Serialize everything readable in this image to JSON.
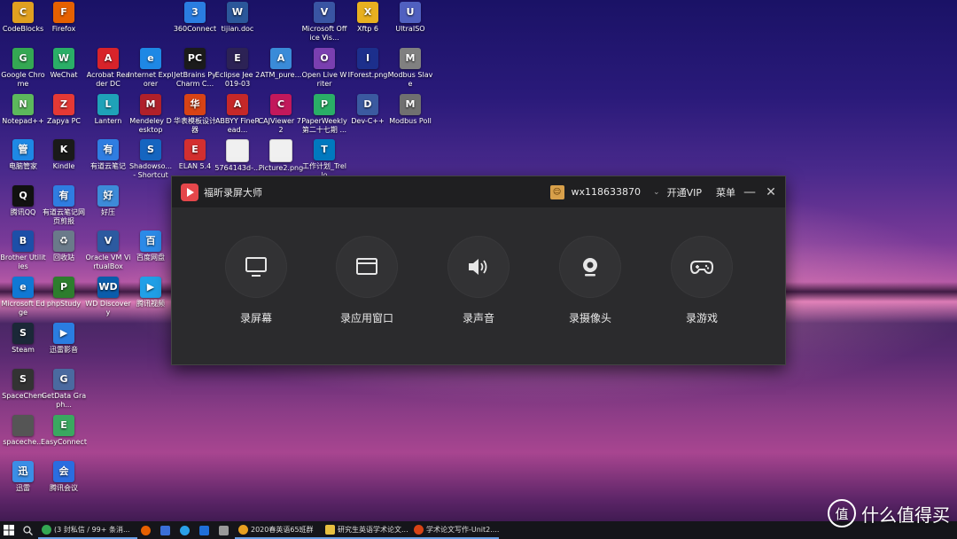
{
  "desktop": {
    "icons": [
      {
        "label": "CodeBlocks",
        "glyph": "C",
        "color": "#e0a020",
        "col": 0,
        "row": 0
      },
      {
        "label": "Firefox",
        "glyph": "F",
        "color": "#e66000",
        "col": 1,
        "row": 0
      },
      {
        "label": "360Connect",
        "glyph": "3",
        "color": "#2a7de1",
        "col": 4,
        "row": 0
      },
      {
        "label": "tijian.doc",
        "glyph": "W",
        "color": "#2b579a",
        "col": 5,
        "row": 0
      },
      {
        "label": "Microsoft Office Vis...",
        "glyph": "V",
        "color": "#3955a3",
        "col": 7,
        "row": 0
      },
      {
        "label": "Xftp 6",
        "glyph": "X",
        "color": "#e8b020",
        "col": 8,
        "row": 0
      },
      {
        "label": "UltraISO",
        "glyph": "U",
        "color": "#5060c0",
        "col": 9,
        "row": 0
      },
      {
        "label": "Google Chrome",
        "glyph": "G",
        "color": "#34a853",
        "col": 0,
        "row": 1
      },
      {
        "label": "WeChat",
        "glyph": "W",
        "color": "#2aae67",
        "col": 1,
        "row": 1
      },
      {
        "label": "Acrobat Reader DC",
        "glyph": "A",
        "color": "#d8232a",
        "col": 2,
        "row": 1
      },
      {
        "label": "Internet Explorer",
        "glyph": "e",
        "color": "#1e88e5",
        "col": 3,
        "row": 1
      },
      {
        "label": "JetBrains PyCharm C...",
        "glyph": "PC",
        "color": "#1b1b1b",
        "col": 4,
        "row": 1
      },
      {
        "label": "Eclipse Jee 2019-03",
        "glyph": "E",
        "color": "#2c2255",
        "col": 5,
        "row": 1
      },
      {
        "label": "ATM_pure...",
        "glyph": "A",
        "color": "#3a8bd8",
        "col": 6,
        "row": 1
      },
      {
        "label": "Open Live Writer",
        "glyph": "O",
        "color": "#7a3fb0",
        "col": 7,
        "row": 1
      },
      {
        "label": "IForest.png",
        "glyph": "I",
        "color": "#1c2f8c",
        "col": 8,
        "row": 1
      },
      {
        "label": "Modbus Slave",
        "glyph": "M",
        "color": "#808080",
        "col": 9,
        "row": 1
      },
      {
        "label": "Notepad++",
        "glyph": "N",
        "color": "#5cb85c",
        "col": 0,
        "row": 2
      },
      {
        "label": "Zapya PC",
        "glyph": "Z",
        "color": "#e53935",
        "col": 1,
        "row": 2
      },
      {
        "label": "Lantern",
        "glyph": "L",
        "color": "#1fa2b8",
        "col": 2,
        "row": 2
      },
      {
        "label": "Mendeley Desktop",
        "glyph": "M",
        "color": "#b0202a",
        "col": 3,
        "row": 2
      },
      {
        "label": "华表模板设计器",
        "glyph": "华",
        "color": "#d84315",
        "col": 4,
        "row": 2
      },
      {
        "label": "ABBYY FineRead...",
        "glyph": "A",
        "color": "#c62828",
        "col": 5,
        "row": 2
      },
      {
        "label": "CAJViewer 7.2",
        "glyph": "C",
        "color": "#c2185b",
        "col": 6,
        "row": 2
      },
      {
        "label": "PaperWeekly 第二十七期 ...",
        "glyph": "P",
        "color": "#2aae67",
        "col": 7,
        "row": 2
      },
      {
        "label": "Dev-C++",
        "glyph": "D",
        "color": "#3b5aa0",
        "col": 8,
        "row": 2
      },
      {
        "label": "Modbus Poll",
        "glyph": "M",
        "color": "#707070",
        "col": 9,
        "row": 2
      },
      {
        "label": "电脑管家",
        "glyph": "管",
        "color": "#1e88e5",
        "col": 0,
        "row": 3
      },
      {
        "label": "Kindle",
        "glyph": "K",
        "color": "#1a1a1a",
        "col": 1,
        "row": 3
      },
      {
        "label": "有道云笔记",
        "glyph": "有",
        "color": "#2f7de1",
        "col": 2,
        "row": 3
      },
      {
        "label": "Shadowso... - Shortcut",
        "glyph": "S",
        "color": "#1565c0",
        "col": 3,
        "row": 3
      },
      {
        "label": "ELAN 5.4",
        "glyph": "E",
        "color": "#d32f2f",
        "col": 4,
        "row": 3
      },
      {
        "label": "5764143d-...",
        "glyph": "",
        "color": "#f0f0f0",
        "col": 5,
        "row": 3
      },
      {
        "label": "Picture2.png",
        "glyph": "",
        "color": "#f0f0f0",
        "col": 6,
        "row": 3
      },
      {
        "label": "工作计划_Trello",
        "glyph": "T",
        "color": "#0079bf",
        "col": 7,
        "row": 3
      },
      {
        "label": "腾讯QQ",
        "glyph": "Q",
        "color": "#111111",
        "col": 0,
        "row": 4
      },
      {
        "label": "有道云笔记网页剪报",
        "glyph": "有",
        "color": "#2f7de1",
        "col": 1,
        "row": 4
      },
      {
        "label": "好压",
        "glyph": "好",
        "color": "#3d8bd8",
        "col": 2,
        "row": 4
      },
      {
        "label": "Brother Utilities",
        "glyph": "B",
        "color": "#1d4fa8",
        "col": 0,
        "row": 5
      },
      {
        "label": "回收站",
        "glyph": "♻",
        "color": "#6a7a8a",
        "col": 1,
        "row": 5
      },
      {
        "label": "Oracle VM VirtualBox",
        "glyph": "V",
        "color": "#2c5aa0",
        "col": 2,
        "row": 5
      },
      {
        "label": "百度网盘",
        "glyph": "百",
        "color": "#2b8ae8",
        "col": 3,
        "row": 5
      },
      {
        "label": "Microsoft Edge",
        "glyph": "e",
        "color": "#0f78d4",
        "col": 0,
        "row": 6
      },
      {
        "label": "phpStudy",
        "glyph": "P",
        "color": "#2d7d2d",
        "col": 1,
        "row": 6
      },
      {
        "label": "WD Discovery",
        "glyph": "WD",
        "color": "#0a5cab",
        "col": 2,
        "row": 6
      },
      {
        "label": "腾讯视频",
        "glyph": "▶",
        "color": "#20a0e8",
        "col": 3,
        "row": 6
      },
      {
        "label": "Steam",
        "glyph": "S",
        "color": "#1b2838",
        "col": 0,
        "row": 7
      },
      {
        "label": "迅雷影音",
        "glyph": "▶",
        "color": "#2a7de1",
        "col": 1,
        "row": 7
      },
      {
        "label": "SpaceChem",
        "glyph": "S",
        "color": "#333333",
        "col": 0,
        "row": 8
      },
      {
        "label": "GetData Graph...",
        "glyph": "G",
        "color": "#4a6aa0",
        "col": 1,
        "row": 8
      },
      {
        "label": "spaceche...",
        "glyph": "",
        "color": "#555555",
        "col": 0,
        "row": 9
      },
      {
        "label": "EasyConnect",
        "glyph": "E",
        "color": "#3aa860",
        "col": 1,
        "row": 9
      },
      {
        "label": "迅雷",
        "glyph": "迅",
        "color": "#3b8ee6",
        "col": 0,
        "row": 10
      },
      {
        "label": "腾讯会议",
        "glyph": "会",
        "color": "#2a6de0",
        "col": 1,
        "row": 10
      }
    ]
  },
  "recorder": {
    "title": "福昕录屏大师",
    "username": "wx118633870",
    "vip_label": "开通VIP",
    "menu_label": "菜单",
    "minimize_glyph": "—",
    "close_glyph": "✕",
    "modes": [
      {
        "label": "录屏幕",
        "icon": "monitor-icon"
      },
      {
        "label": "录应用窗口",
        "icon": "window-icon"
      },
      {
        "label": "录声音",
        "icon": "speaker-icon"
      },
      {
        "label": "录摄像头",
        "icon": "webcam-icon"
      },
      {
        "label": "录游戏",
        "icon": "gamepad-icon"
      }
    ]
  },
  "taskbar": {
    "tasks": [
      {
        "label": "(3 封私信 / 99+ 条消...",
        "color": "#34a853"
      },
      {
        "label": "2020春英语65班群",
        "color": "#e8a020"
      },
      {
        "label": "研究生英语学术论文...",
        "color": "#e8c040"
      },
      {
        "label": "学术论文写作-Unit2....",
        "color": "#d84315"
      }
    ]
  },
  "watermark": {
    "glyph": "值",
    "text": "什么值得买"
  }
}
